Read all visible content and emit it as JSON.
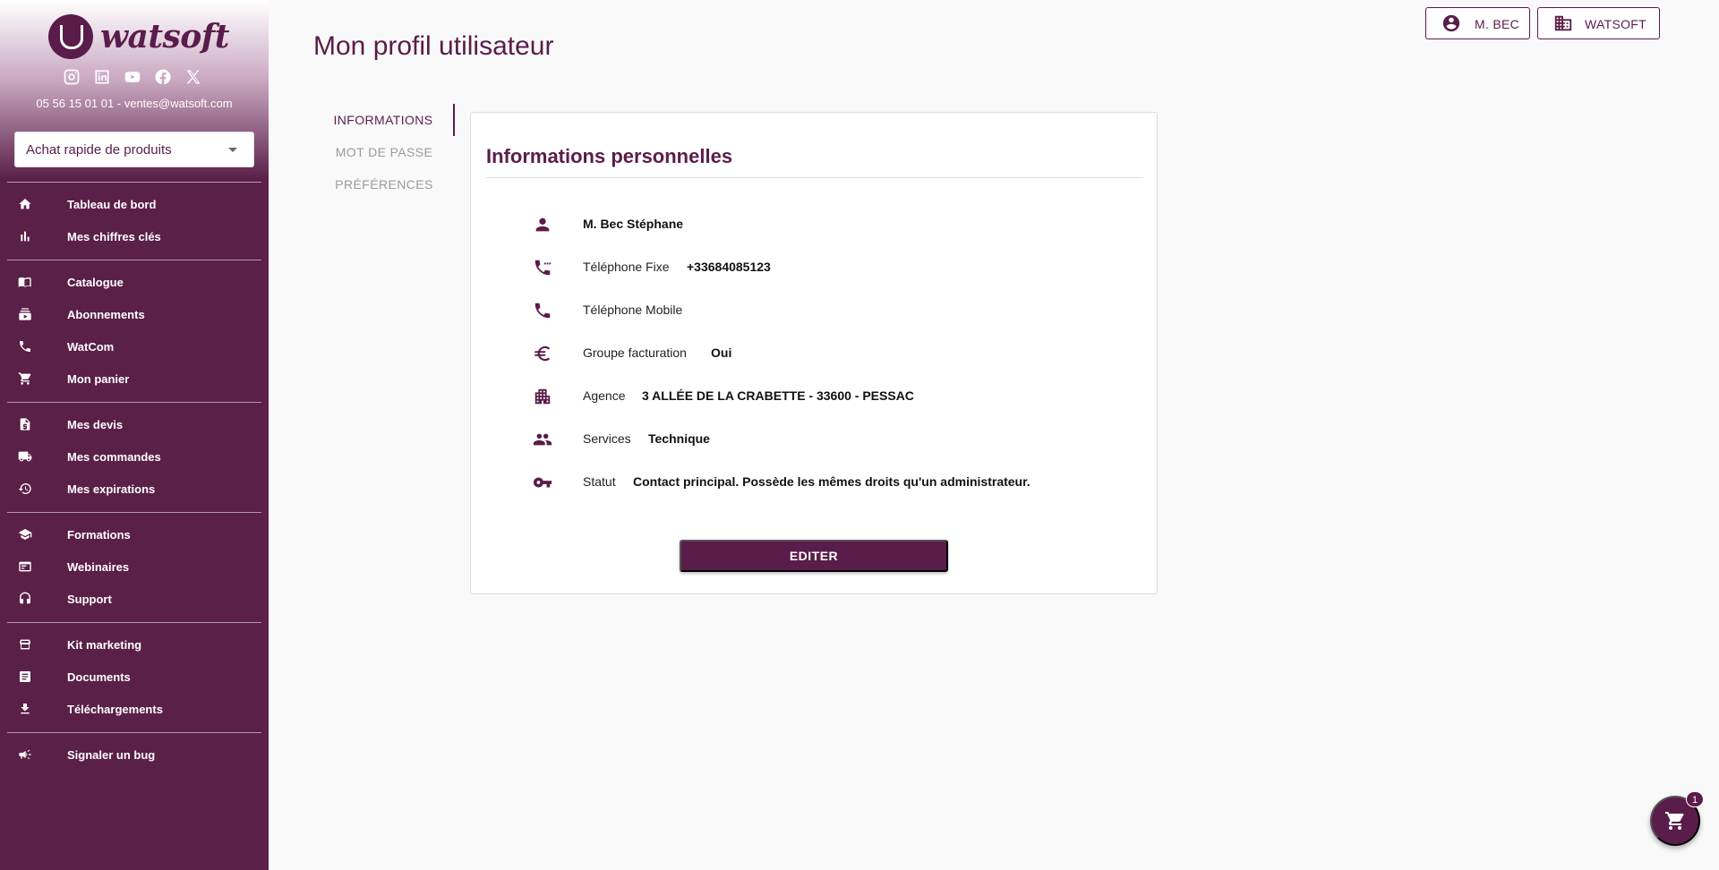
{
  "sidebar": {
    "brand": "watsoft",
    "socials": [
      "instagram-icon",
      "linkedin-icon",
      "youtube-icon",
      "facebook-icon",
      "x-icon"
    ],
    "contact": "05 56 15 01 01 - ventes@watsoft.com",
    "quick_buy": "Achat rapide de produits",
    "items": [
      {
        "label": "Tableau de bord",
        "icon": "home-icon"
      },
      {
        "label": "Mes chiffres clés",
        "icon": "bar-chart-icon"
      },
      {
        "label": "Catalogue",
        "icon": "book-open-icon"
      },
      {
        "label": "Abonnements",
        "icon": "subscriptions-icon"
      },
      {
        "label": "WatCom",
        "icon": "phone-icon"
      },
      {
        "label": "Mon panier",
        "icon": "cart-icon"
      },
      {
        "label": "Mes devis",
        "icon": "quote-doc-icon"
      },
      {
        "label": "Mes commandes",
        "icon": "truck-icon"
      },
      {
        "label": "Mes expirations",
        "icon": "history-icon"
      },
      {
        "label": "Formations",
        "icon": "school-icon"
      },
      {
        "label": "Webinaires",
        "icon": "webinar-icon"
      },
      {
        "label": "Support",
        "icon": "headset-icon"
      },
      {
        "label": "Kit marketing",
        "icon": "store-icon"
      },
      {
        "label": "Documents",
        "icon": "document-icon"
      },
      {
        "label": "Téléchargements",
        "icon": "download-icon"
      },
      {
        "label": "Signaler un bug",
        "icon": "campaign-icon"
      }
    ]
  },
  "header": {
    "title": "Mon profil utilisateur",
    "user_button": "M. BEC",
    "org_button": "WATSOFT"
  },
  "tabs": [
    {
      "label": "INFORMATIONS",
      "active": true
    },
    {
      "label": "MOT DE PASSE",
      "active": false
    },
    {
      "label": "PRÉFÉRENCES",
      "active": false
    }
  ],
  "card": {
    "title": "Informations personnelles",
    "rows": [
      {
        "icon": "person-icon",
        "label": "",
        "value": "M. Bec Stéphane"
      },
      {
        "icon": "landline-phone-icon",
        "label": "Téléphone Fixe",
        "value": "+33684085123"
      },
      {
        "icon": "mobile-phone-icon",
        "label": "Téléphone Mobile",
        "value": ""
      },
      {
        "icon": "euro-icon",
        "label": "Groupe facturation",
        "value": "Oui"
      },
      {
        "icon": "building-icon",
        "label": "Agence",
        "value": "3 ALLÉE DE LA CRABETTE - 33600 - PESSAC"
      },
      {
        "icon": "group-icon",
        "label": "Services",
        "value": "Technique"
      },
      {
        "icon": "key-icon",
        "label": "Statut",
        "value": "Contact principal. Possède les mêmes droits qu'un administrateur."
      }
    ],
    "edit_label": "EDITER"
  },
  "cart": {
    "count": "1"
  },
  "colors": {
    "primary": "#5a1c4a",
    "background": "#f9f9f9"
  }
}
